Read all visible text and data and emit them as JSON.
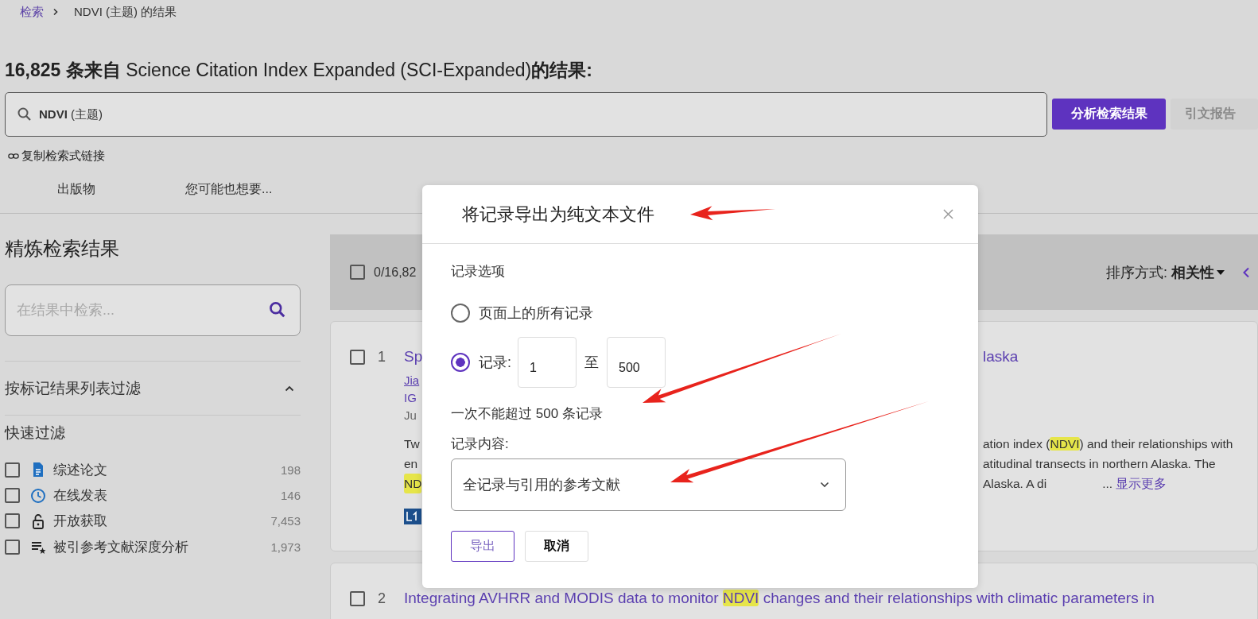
{
  "breadcrumb": {
    "link": "检索",
    "current": "NDVI (主题) 的结果"
  },
  "heading": "**16,825 条来自** Science Citation Index Expanded (SCI-Expanded)**的结果:**",
  "search": {
    "value": "**NDVI** (主题)"
  },
  "actions": [
    {
      "label": "分析检索结果",
      "kind": "primary"
    },
    {
      "label": "引文报告",
      "kind": "secondary"
    }
  ],
  "copy_link": "复制检索式链接",
  "tabs": [
    {
      "label": "出版物"
    },
    {
      "label": "您可能也想要..."
    }
  ],
  "sidebar": {
    "title": "精炼检索结果",
    "search_placeholder": "在结果中检索...",
    "filter_section": {
      "label": "按标记结果列表过滤",
      "expanded": true
    },
    "quick_filter_title": "快速过滤",
    "quick_filters": [
      {
        "label": "综述论文",
        "count": "198",
        "checked": false
      },
      {
        "label": "在线发表",
        "count": "146",
        "checked": false
      },
      {
        "label": "开放获取",
        "count": "7,453",
        "checked": false
      },
      {
        "label": "被引参考文献深度分析",
        "count": "1,973",
        "checked": false
      }
    ]
  },
  "results_header": {
    "select_all": {
      "label": "0/16,82",
      "checked": false
    },
    "sort": "排序方式: **相关性**"
  },
  "first_result": {
    "number": "1",
    "checked": false,
    "title_left": "Sp",
    "title_right": "laska",
    "meta_left": [
      "Jia",
      "IG",
      "Ju"
    ],
    "abstract_left": [
      {
        "text": "Tw",
        "highlight": false
      },
      {
        "text": "en",
        "highlight": false
      },
      {
        "text": "ND",
        "highlight": true
      }
    ],
    "abstract_right": [
      [
        {
          "text": "ation index (",
          "highlight": false
        },
        {
          "text": "NDVI",
          "highlight": true
        },
        {
          "text": ") and their relationships with",
          "highlight": false
        }
      ],
      [
        {
          "text": "atitudinal transects in northern Alaska. The",
          "highlight": false
        }
      ],
      [
        {
          "text": "Alaska. A di",
          "highlight": false
        }
      ]
    ],
    "ellipsis": "...",
    "show_more": "显示更多"
  },
  "second_result": {
    "number": "2",
    "checked": false,
    "title": [
      {
        "text": "Integrating AVHRR and MODIS data to monitor ",
        "highlight": false
      },
      {
        "text": "NDVI",
        "highlight": true
      },
      {
        "text": " changes and their relationships with climatic parameters in",
        "highlight": false
      }
    ]
  },
  "modal": {
    "title": "将记录导出为纯文本文件",
    "section_label": "记录选项",
    "options": [
      {
        "kind": "plain",
        "label": "页面上的所有记录",
        "selected": false
      },
      {
        "kind": "range",
        "label": "记录:",
        "selected": true,
        "from": "1",
        "separator": "至",
        "to": "500"
      }
    ],
    "note": "一次不能超过 500 条记录",
    "content_label": "记录内容:",
    "content_value": "全记录与引用的参考文献",
    "buttons": [
      {
        "label": "导出",
        "kind": "outline"
      },
      {
        "label": "取消",
        "kind": "plain"
      }
    ]
  }
}
